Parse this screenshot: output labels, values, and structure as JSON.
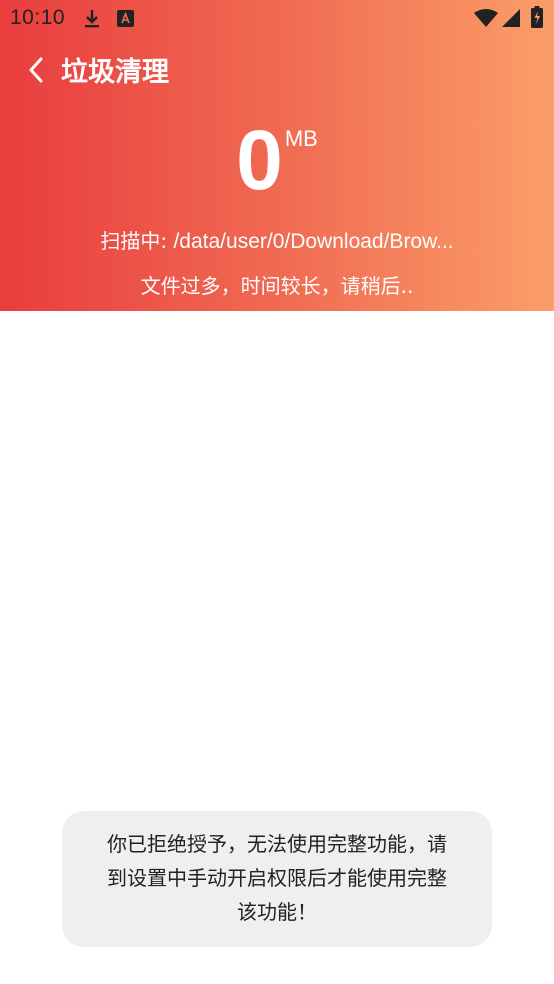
{
  "status_bar": {
    "time": "10:10",
    "icons": [
      "download-icon",
      "app-notification-icon",
      "wifi-icon",
      "signal-icon",
      "battery-charging-icon"
    ]
  },
  "header": {
    "back_icon": "chevron-left-icon",
    "title": "垃圾清理",
    "size_value": "0",
    "size_unit": "MB",
    "scan_prefix": "扫描中: ",
    "scan_path": "/data/user/0/Download/Brow...",
    "note": "文件过多，时间较长，请稍后.."
  },
  "toast": {
    "lines": [
      "你已拒绝授予，无法使用完整功能，请",
      "到设置中手动开启权限后才能使用完整",
      "该功能！"
    ]
  },
  "colors": {
    "gradient_start": "#e93d3e",
    "gradient_end": "#fb9e68",
    "toast_bg": "#efefef"
  }
}
